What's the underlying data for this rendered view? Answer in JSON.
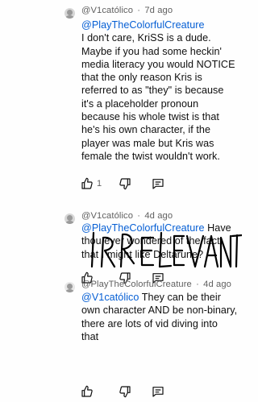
{
  "comments": [
    {
      "author": "@V1católico",
      "time": "7d ago",
      "mention": "@PlayTheColorfulCreature",
      "lines": [
        "I don't care, KriSS is a dude.",
        "Maybe if you had some heckin'",
        "media literacy you would NOTICE",
        "that the only reason Kris is",
        "referred to as \"they\" is because",
        "it's a placeholder pronoun",
        "because his whole twist is that",
        "he's his own character, if the",
        "player was male but Kris was",
        "female the twist wouldn't work."
      ],
      "like_count": "1"
    },
    {
      "author": "@V1católico",
      "time": "4d ago",
      "mention": "@PlayTheColorfulCreature",
      "first_line_rest": "Have",
      "lines": [
        "thou ever wondered of the fact",
        "that I might like Deltarune?"
      ],
      "like_count": "",
      "scribble_text": "IRRELEVANT"
    },
    {
      "author": "@PlayTheColorfulCreature",
      "time": "4d ago",
      "mention": "@V1católico",
      "first_line_rest": "They can be their",
      "lines": [
        "own character AND be non-binary,",
        "there are lots of vid diving into",
        "that"
      ],
      "like_count": ""
    }
  ],
  "separator": "·"
}
